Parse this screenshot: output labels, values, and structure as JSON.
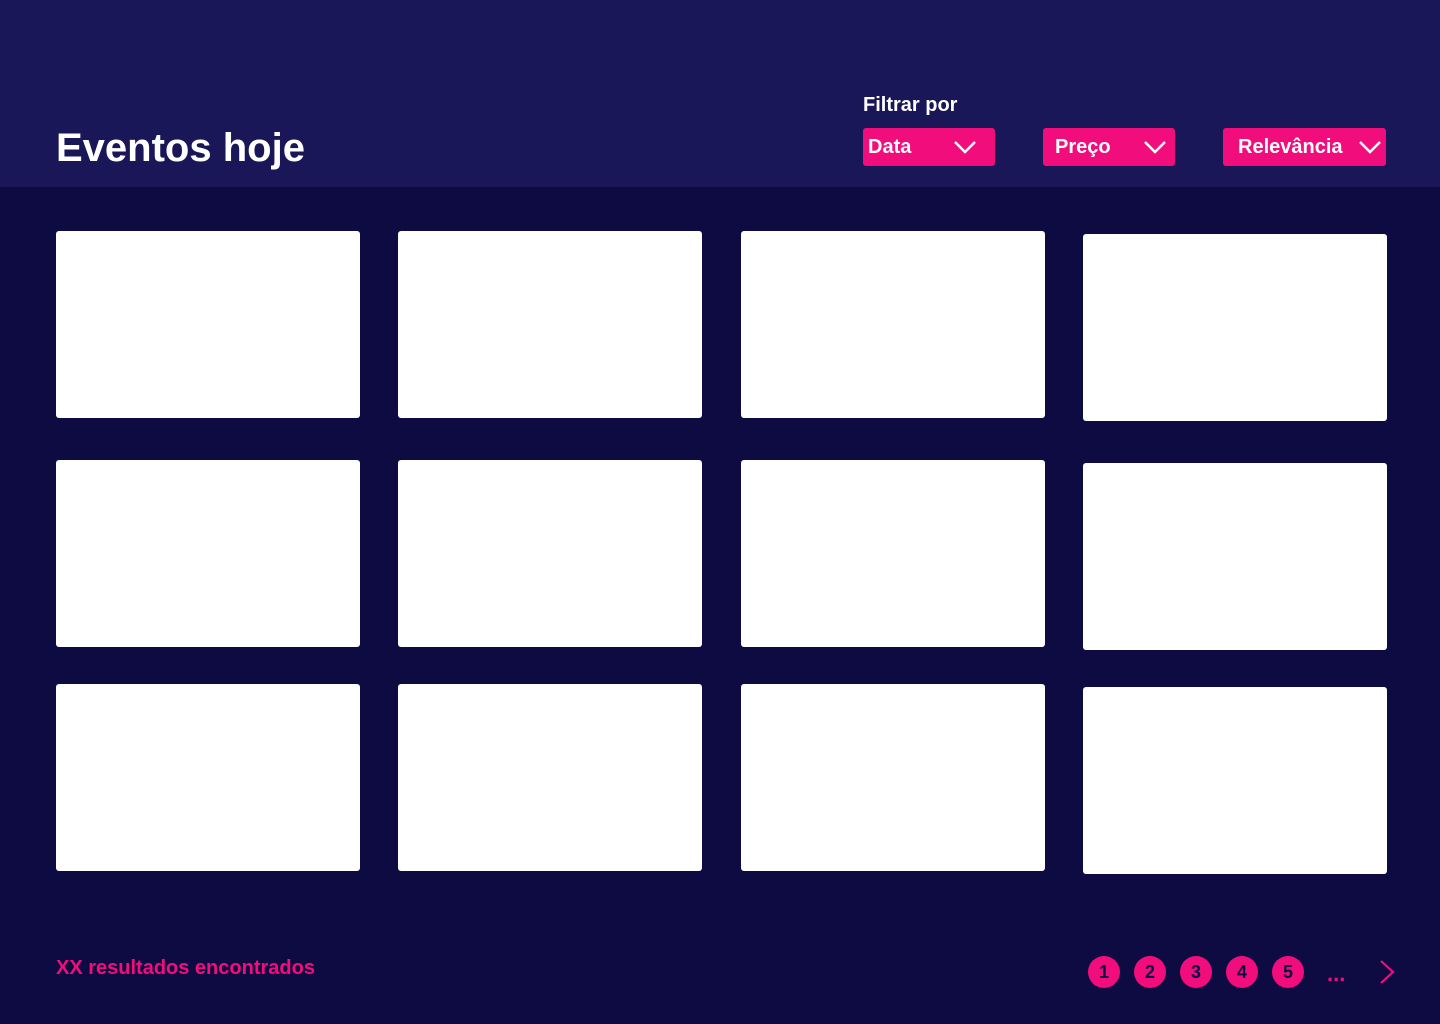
{
  "header": {
    "title": "Eventos hoje",
    "filter_label": "Filtrar por",
    "filters": [
      {
        "label": "Data",
        "icon": "chevron-down-icon"
      },
      {
        "label": "Preço",
        "icon": "chevron-down-icon"
      },
      {
        "label": "Relevância",
        "icon": "chevron-down-icon"
      }
    ]
  },
  "results": {
    "count_text": "XX resultados encontrados"
  },
  "pagination": {
    "pages": [
      "1",
      "2",
      "3",
      "4",
      "5"
    ],
    "ellipsis": "...",
    "next_icon": "chevron-right-icon"
  },
  "colors": {
    "header_bg": "#1a1759",
    "page_bg": "#0e0a42",
    "accent": "#f20d7c",
    "card_bg": "#ffffff"
  }
}
